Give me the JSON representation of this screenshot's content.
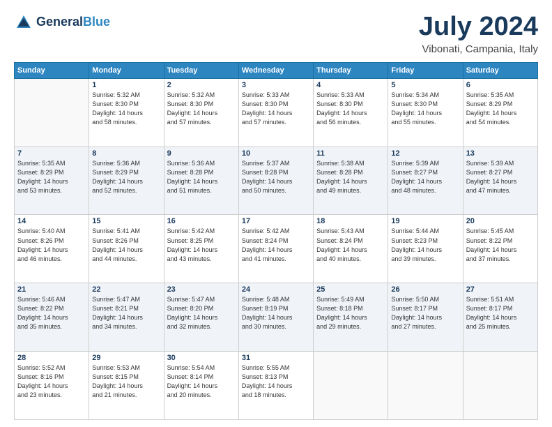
{
  "logo": {
    "line1": "General",
    "line2": "Blue"
  },
  "title": "July 2024",
  "location": "Vibonati, Campania, Italy",
  "weekdays": [
    "Sunday",
    "Monday",
    "Tuesday",
    "Wednesday",
    "Thursday",
    "Friday",
    "Saturday"
  ],
  "weeks": [
    [
      {
        "day": "",
        "info": ""
      },
      {
        "day": "1",
        "info": "Sunrise: 5:32 AM\nSunset: 8:30 PM\nDaylight: 14 hours\nand 58 minutes."
      },
      {
        "day": "2",
        "info": "Sunrise: 5:32 AM\nSunset: 8:30 PM\nDaylight: 14 hours\nand 57 minutes."
      },
      {
        "day": "3",
        "info": "Sunrise: 5:33 AM\nSunset: 8:30 PM\nDaylight: 14 hours\nand 57 minutes."
      },
      {
        "day": "4",
        "info": "Sunrise: 5:33 AM\nSunset: 8:30 PM\nDaylight: 14 hours\nand 56 minutes."
      },
      {
        "day": "5",
        "info": "Sunrise: 5:34 AM\nSunset: 8:30 PM\nDaylight: 14 hours\nand 55 minutes."
      },
      {
        "day": "6",
        "info": "Sunrise: 5:35 AM\nSunset: 8:29 PM\nDaylight: 14 hours\nand 54 minutes."
      }
    ],
    [
      {
        "day": "7",
        "info": "Sunrise: 5:35 AM\nSunset: 8:29 PM\nDaylight: 14 hours\nand 53 minutes."
      },
      {
        "day": "8",
        "info": "Sunrise: 5:36 AM\nSunset: 8:29 PM\nDaylight: 14 hours\nand 52 minutes."
      },
      {
        "day": "9",
        "info": "Sunrise: 5:36 AM\nSunset: 8:28 PM\nDaylight: 14 hours\nand 51 minutes."
      },
      {
        "day": "10",
        "info": "Sunrise: 5:37 AM\nSunset: 8:28 PM\nDaylight: 14 hours\nand 50 minutes."
      },
      {
        "day": "11",
        "info": "Sunrise: 5:38 AM\nSunset: 8:28 PM\nDaylight: 14 hours\nand 49 minutes."
      },
      {
        "day": "12",
        "info": "Sunrise: 5:39 AM\nSunset: 8:27 PM\nDaylight: 14 hours\nand 48 minutes."
      },
      {
        "day": "13",
        "info": "Sunrise: 5:39 AM\nSunset: 8:27 PM\nDaylight: 14 hours\nand 47 minutes."
      }
    ],
    [
      {
        "day": "14",
        "info": "Sunrise: 5:40 AM\nSunset: 8:26 PM\nDaylight: 14 hours\nand 46 minutes."
      },
      {
        "day": "15",
        "info": "Sunrise: 5:41 AM\nSunset: 8:26 PM\nDaylight: 14 hours\nand 44 minutes."
      },
      {
        "day": "16",
        "info": "Sunrise: 5:42 AM\nSunset: 8:25 PM\nDaylight: 14 hours\nand 43 minutes."
      },
      {
        "day": "17",
        "info": "Sunrise: 5:42 AM\nSunset: 8:24 PM\nDaylight: 14 hours\nand 41 minutes."
      },
      {
        "day": "18",
        "info": "Sunrise: 5:43 AM\nSunset: 8:24 PM\nDaylight: 14 hours\nand 40 minutes."
      },
      {
        "day": "19",
        "info": "Sunrise: 5:44 AM\nSunset: 8:23 PM\nDaylight: 14 hours\nand 39 minutes."
      },
      {
        "day": "20",
        "info": "Sunrise: 5:45 AM\nSunset: 8:22 PM\nDaylight: 14 hours\nand 37 minutes."
      }
    ],
    [
      {
        "day": "21",
        "info": "Sunrise: 5:46 AM\nSunset: 8:22 PM\nDaylight: 14 hours\nand 35 minutes."
      },
      {
        "day": "22",
        "info": "Sunrise: 5:47 AM\nSunset: 8:21 PM\nDaylight: 14 hours\nand 34 minutes."
      },
      {
        "day": "23",
        "info": "Sunrise: 5:47 AM\nSunset: 8:20 PM\nDaylight: 14 hours\nand 32 minutes."
      },
      {
        "day": "24",
        "info": "Sunrise: 5:48 AM\nSunset: 8:19 PM\nDaylight: 14 hours\nand 30 minutes."
      },
      {
        "day": "25",
        "info": "Sunrise: 5:49 AM\nSunset: 8:18 PM\nDaylight: 14 hours\nand 29 minutes."
      },
      {
        "day": "26",
        "info": "Sunrise: 5:50 AM\nSunset: 8:17 PM\nDaylight: 14 hours\nand 27 minutes."
      },
      {
        "day": "27",
        "info": "Sunrise: 5:51 AM\nSunset: 8:17 PM\nDaylight: 14 hours\nand 25 minutes."
      }
    ],
    [
      {
        "day": "28",
        "info": "Sunrise: 5:52 AM\nSunset: 8:16 PM\nDaylight: 14 hours\nand 23 minutes."
      },
      {
        "day": "29",
        "info": "Sunrise: 5:53 AM\nSunset: 8:15 PM\nDaylight: 14 hours\nand 21 minutes."
      },
      {
        "day": "30",
        "info": "Sunrise: 5:54 AM\nSunset: 8:14 PM\nDaylight: 14 hours\nand 20 minutes."
      },
      {
        "day": "31",
        "info": "Sunrise: 5:55 AM\nSunset: 8:13 PM\nDaylight: 14 hours\nand 18 minutes."
      },
      {
        "day": "",
        "info": ""
      },
      {
        "day": "",
        "info": ""
      },
      {
        "day": "",
        "info": ""
      }
    ]
  ]
}
